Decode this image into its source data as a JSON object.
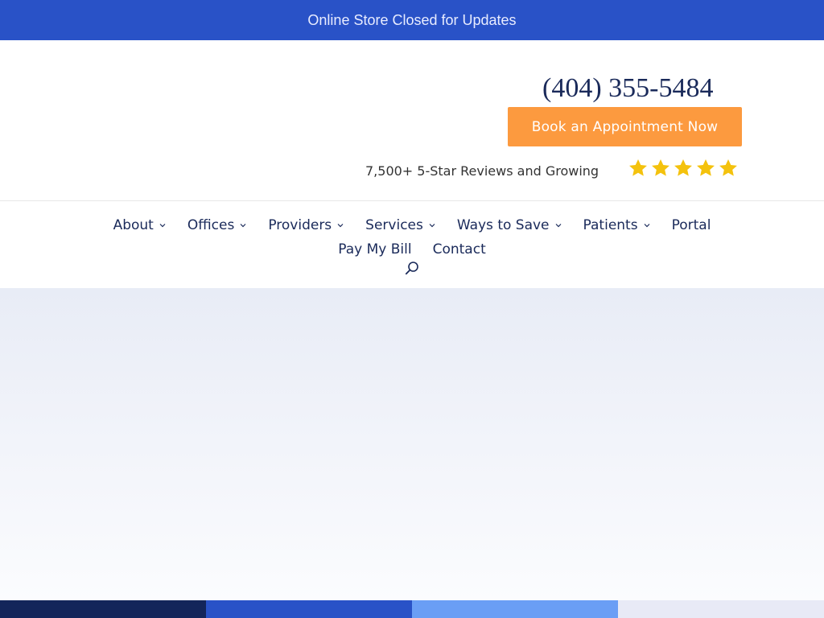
{
  "colors": {
    "topbar_bg": "#2952c7",
    "topbar_text": "#e8ecff",
    "navy": "#1a2a5a",
    "button_bg": "#fc9a3f",
    "star": "#f4c20d",
    "strip": [
      "#13255a",
      "#2952c7",
      "#6a9ef5",
      "#e8eaf6"
    ]
  },
  "topbar": {
    "text": "Online Store Closed for Updates"
  },
  "header": {
    "phone": "(404) 355-5484",
    "book_button": "Book an Appointment Now",
    "reviews_text": "7,500+ 5-Star Reviews and Growing",
    "star_count": 5
  },
  "nav": {
    "items": [
      {
        "label": "About",
        "dropdown": true
      },
      {
        "label": "Offices",
        "dropdown": true
      },
      {
        "label": "Providers",
        "dropdown": true
      },
      {
        "label": "Services",
        "dropdown": true
      },
      {
        "label": "Ways to Save",
        "dropdown": true
      },
      {
        "label": "Patients",
        "dropdown": true
      },
      {
        "label": "Portal",
        "dropdown": false
      },
      {
        "label": "Pay My Bill",
        "dropdown": false
      },
      {
        "label": "Contact",
        "dropdown": false
      }
    ],
    "search_icon": "search-icon"
  }
}
